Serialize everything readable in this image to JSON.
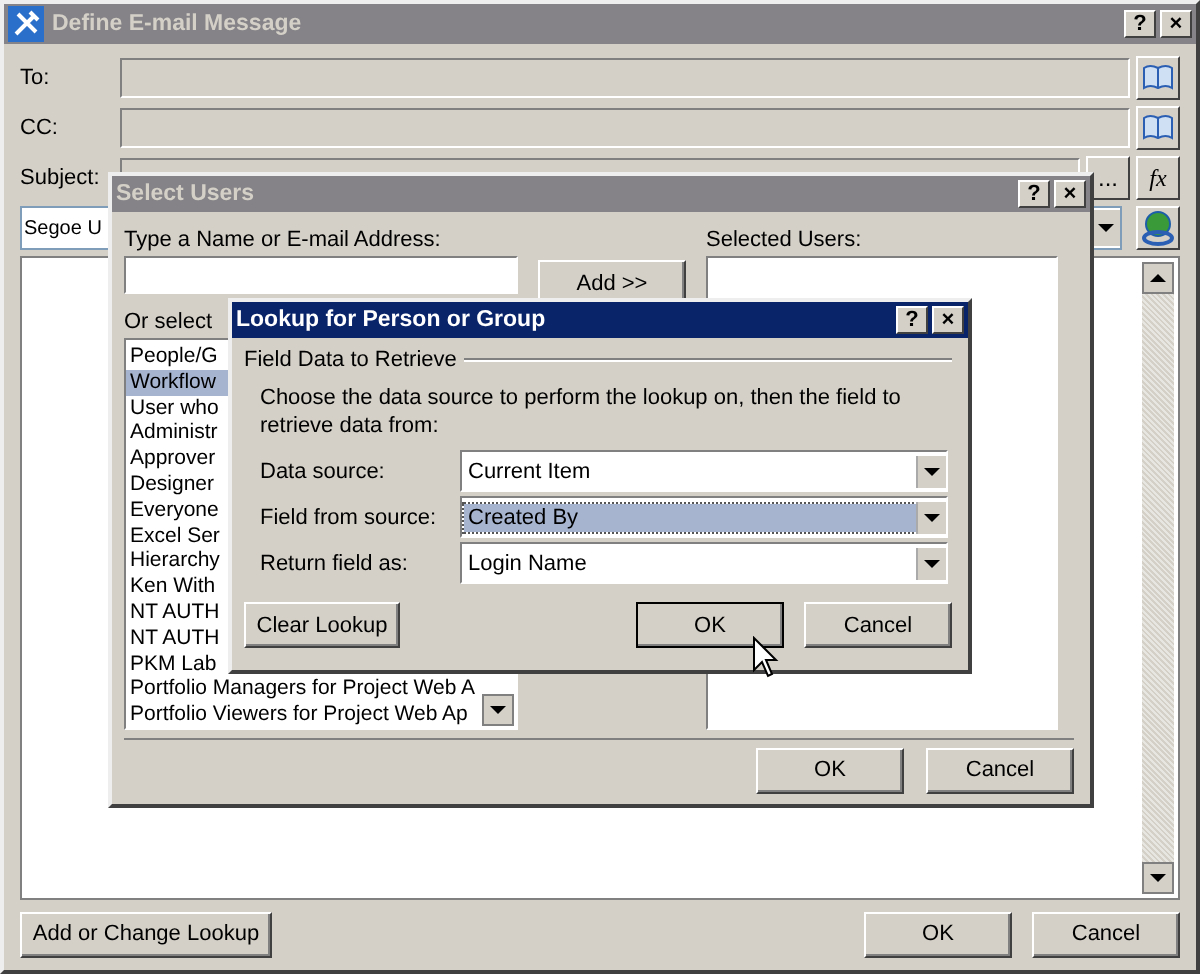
{
  "main_window": {
    "title": "Define E-mail Message",
    "active": false,
    "title_buttons": [
      "?",
      "×"
    ],
    "fields": [
      {
        "label": "To:",
        "kind": "address"
      },
      {
        "label": "CC:",
        "kind": "address"
      },
      {
        "label": "Subject:",
        "kind": "subject"
      }
    ],
    "subject_buttons": [
      "...",
      "fx"
    ],
    "font": "Segoe U",
    "buttons": [
      "Add or Change Lookup",
      "OK",
      "Cancel"
    ]
  },
  "select_users": {
    "title": "Select Users",
    "active": false,
    "title_buttons": [
      "?",
      "×"
    ],
    "name_label": "Type a Name or E-mail Address:",
    "add_button": "Add >>",
    "selected_label": "Selected Users:",
    "list_label": "Or select",
    "users": [
      {
        "name": "People/G",
        "selected": false
      },
      {
        "name": "Workflow",
        "selected": true
      },
      {
        "name": "User who",
        "selected": false
      },
      {
        "name": "Administr",
        "selected": false
      },
      {
        "name": "Approver",
        "selected": false
      },
      {
        "name": "Designer",
        "selected": false
      },
      {
        "name": "Everyone",
        "selected": false
      },
      {
        "name": "Excel Ser",
        "selected": false
      },
      {
        "name": "Hierarchy",
        "selected": false
      },
      {
        "name": "Ken With",
        "selected": false
      },
      {
        "name": "NT AUTH",
        "selected": false
      },
      {
        "name": "NT AUTH",
        "selected": false
      },
      {
        "name": "PKM Lab",
        "selected": false
      },
      {
        "name": "Portfolio Managers for Project Web A",
        "selected": false
      },
      {
        "name": "Portfolio Viewers for Project Web Ap",
        "selected": false
      }
    ],
    "buttons": [
      "OK",
      "Cancel"
    ]
  },
  "lookup": {
    "title": "Lookup for Person or Group",
    "active": true,
    "title_buttons": [
      "?",
      "×"
    ],
    "group": "Field Data to Retrieve",
    "description": "Choose the data source to perform the lookup on, then the field to retrieve data from:",
    "rows": [
      {
        "label": "Data source:",
        "value": "Current Item",
        "selected": false
      },
      {
        "label": "Field from source:",
        "value": "Created By",
        "selected": true
      },
      {
        "label": "Return field as:",
        "value": "Login Name",
        "selected": false
      }
    ],
    "clear_button": "Clear Lookup",
    "buttons": [
      "OK",
      "Cancel"
    ]
  }
}
